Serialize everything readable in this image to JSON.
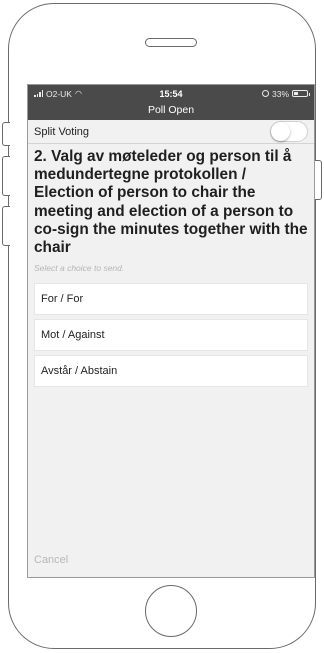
{
  "status_bar": {
    "carrier": "O2-UK",
    "time": "15:54",
    "battery": "33%",
    "battery_level": 0.33,
    "icons": [
      "signal-icon",
      "wifi-icon",
      "alarm-icon",
      "battery-icon"
    ]
  },
  "nav": {
    "title": "Poll Open"
  },
  "split_voting": {
    "label": "Split Voting",
    "enabled": false
  },
  "question": "2. Valg av møteleder og person til å medundertegne protokollen / Election of person to chair the meeting and election of a person to co-sign the minutes together with the chair",
  "hint": "Select a choice to send.",
  "choices": [
    {
      "label": "For / For"
    },
    {
      "label": "Mot / Against"
    },
    {
      "label": "Avstår / Abstain"
    }
  ],
  "cancel_label": "Cancel",
  "colors": {
    "bar": "#4a4a4a",
    "background": "#f1f1f1",
    "choice": "#ffffff"
  }
}
